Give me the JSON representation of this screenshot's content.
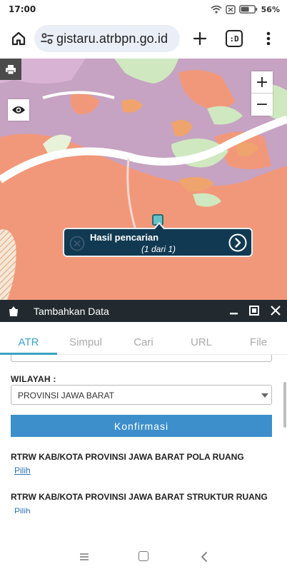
{
  "status_bar": {
    "time": "17:00",
    "battery": "56%",
    "icons": [
      "wifi-icon",
      "battery-saver-icon",
      "battery-icon"
    ]
  },
  "browser": {
    "url": "gistaru.atrbpn.go.id",
    "tab_count": ":D",
    "icons": [
      "home-icon",
      "site-info-icon",
      "plus-icon",
      "more-vert-icon"
    ]
  },
  "map": {
    "zoom_in": "+",
    "zoom_out": "−",
    "popup": {
      "title": "Hasil pencarian",
      "subtitle": "(1 dari 1)"
    },
    "colors": {
      "purple": "#c6a3c2",
      "salmon": "#f2987a",
      "orange": "#f0a46d",
      "green": "#cfe8c0",
      "road": "#ffffff"
    }
  },
  "panel": {
    "title": "Tambahkan Data",
    "tabs": [
      {
        "label": "ATR"
      },
      {
        "label": "Simpul"
      },
      {
        "label": "Cari"
      },
      {
        "label": "URL"
      },
      {
        "label": "File"
      }
    ],
    "wilayah_label": "WILAYAH :",
    "wilayah_value": "PROVINSI JAWA BARAT",
    "confirm_label": "Konfirmasi",
    "layers": [
      {
        "title": "RTRW KAB/KOTA PROVINSI JAWA BARAT POLA RUANG",
        "link": "Pilih"
      },
      {
        "title": "RTRW KAB/KOTA PROVINSI JAWA BARAT STRUKTUR RUANG",
        "link": "Pilih"
      }
    ],
    "accent": "#3aa3c5",
    "button_color": "#3d8fcb"
  },
  "nav_bar": {
    "icons": [
      "menu-icon",
      "home-square-icon",
      "back-icon"
    ]
  }
}
